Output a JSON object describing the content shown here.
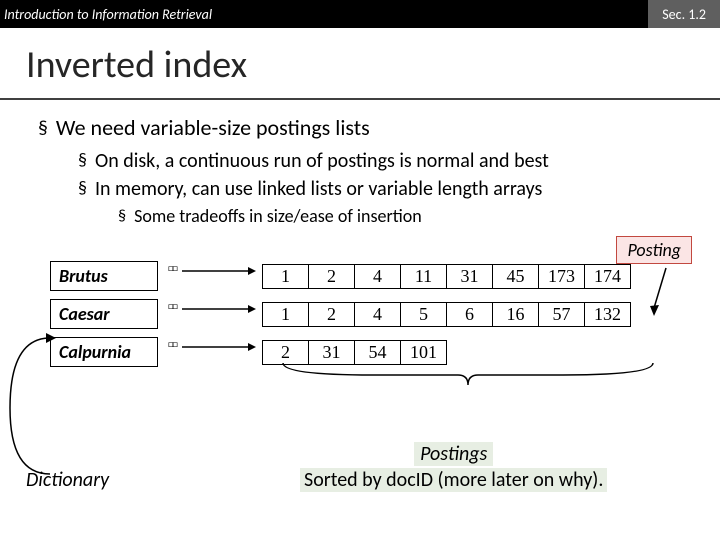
{
  "header": {
    "left": "Introduction to Information Retrieval",
    "right": "Sec. 1.2"
  },
  "title": "Inverted index",
  "bullets": {
    "l1": "We need variable-size postings lists",
    "l2a": "On disk, a continuous run of postings is normal and best",
    "l2b": "In memory, can use linked lists or variable length arrays",
    "l3": "Some tradeoffs in size/ease of insertion"
  },
  "posting_label": "Posting",
  "terms": {
    "t1": "Brutus",
    "t2": "Caesar",
    "t3": "Calpurnia"
  },
  "rows": {
    "r1": [
      "1",
      "2",
      "4",
      "11",
      "31",
      "45",
      "173",
      "174"
    ],
    "r2": [
      "1",
      "2",
      "4",
      "5",
      "6",
      "16",
      "57",
      "132"
    ],
    "r3": [
      "2",
      "31",
      "54",
      "101",
      "",
      "",
      "",
      ""
    ]
  },
  "dictionary_label": "Dictionary",
  "postings_caption": {
    "line1": "Postings",
    "line2": "Sorted by docID (more later on why)."
  }
}
